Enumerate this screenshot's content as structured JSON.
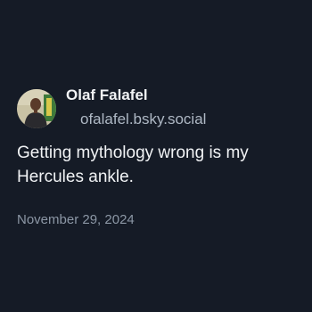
{
  "post": {
    "author": {
      "display_name": "Olaf Falafel",
      "handle": "ofalafel.bsky.social",
      "avatar_icon": "avatar-photo"
    },
    "text": "Getting mythology wrong is my Hercules ankle.",
    "timestamp": "November 29, 2024"
  },
  "colors": {
    "background": "#151b26",
    "primary_text": "#f1f3f5",
    "handle_text": "#aeb8c4",
    "timestamp_text": "#8c97a5"
  }
}
